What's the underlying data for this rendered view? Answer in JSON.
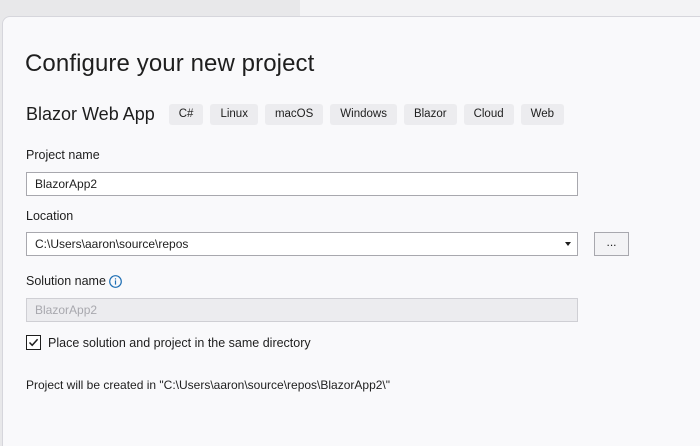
{
  "dialog": {
    "title": "Configure your new project"
  },
  "template": {
    "name": "Blazor Web App",
    "tags": [
      "C#",
      "Linux",
      "macOS",
      "Windows",
      "Blazor",
      "Cloud",
      "Web"
    ]
  },
  "project_name": {
    "label": "Project name",
    "value": "BlazorApp2"
  },
  "location": {
    "label": "Location",
    "value": "C:\\Users\\aaron\\source\\repos",
    "browse_label": "..."
  },
  "solution_name": {
    "label": "Solution name",
    "value": "BlazorApp2",
    "disabled": true
  },
  "same_directory": {
    "label": "Place solution and project in the same directory",
    "checked": true
  },
  "summary": "Project will be created in \"C:\\Users\\aaron\\source\\repos\\BlazorApp2\\\"",
  "colors": {
    "accent": "#1f6fb4",
    "dialog_background": "#f9f9fb",
    "tag_background": "#ececef"
  },
  "icons": {
    "info": "info-icon",
    "dropdown": "chevron-down-icon",
    "checkbox": "checkmark-icon"
  }
}
